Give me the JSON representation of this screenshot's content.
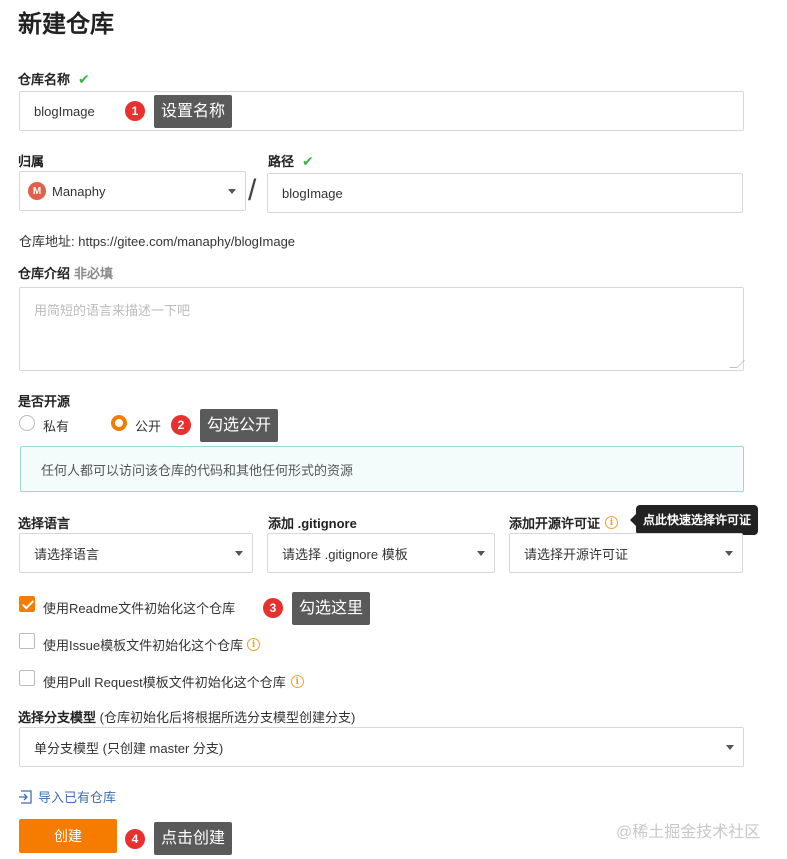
{
  "page": {
    "title": "新建仓库"
  },
  "repo_name": {
    "label": "仓库名称",
    "value": "blogImage",
    "tip": "设置名称",
    "step": "1"
  },
  "owner": {
    "label": "归属",
    "avatar": "M",
    "value": "Manaphy"
  },
  "separator": "/",
  "path": {
    "label": "路径",
    "value": "blogImage"
  },
  "repo_url": {
    "label": "仓库地址:",
    "value": "https://gitee.com/manaphy/blogImage"
  },
  "description": {
    "label": "仓库介绍",
    "optional": "非必填",
    "placeholder": "用简短的语言来描述一下吧"
  },
  "visibility": {
    "label": "是否开源",
    "private_label": "私有",
    "public_label": "公开",
    "selected": "public",
    "tip": "勾选公开",
    "step": "2",
    "notice": "任何人都可以访问该仓库的代码和其他任何形式的资源"
  },
  "language": {
    "label": "选择语言",
    "value": "请选择语言"
  },
  "gitignore": {
    "label": "添加 .gitignore",
    "value": "请选择 .gitignore 模板"
  },
  "license": {
    "label": "添加开源许可证",
    "value": "请选择开源许可证",
    "tooltip": "点此快速选择许可证"
  },
  "init_options": {
    "readme": {
      "label": "使用Readme文件初始化这个仓库",
      "checked": true,
      "tip": "勾选这里",
      "step": "3"
    },
    "issue": {
      "label": "使用Issue模板文件初始化这个仓库",
      "checked": false
    },
    "pr": {
      "label": "使用Pull Request模板文件初始化这个仓库",
      "checked": false
    }
  },
  "branch_model": {
    "label": "选择分支模型",
    "hint": "(仓库初始化后将根据所选分支模型创建分支)",
    "value": "单分支模型 (只创建 master 分支)"
  },
  "import_link": "导入已有仓库",
  "create_button": {
    "label": "创建",
    "tip": "点击创建",
    "step": "4"
  },
  "watermark": "@稀土掘金技术社区",
  "colors": {
    "accent": "#f57c00",
    "success": "#3bb54a",
    "step_badge": "#e8312f",
    "info": "#f0a030"
  }
}
